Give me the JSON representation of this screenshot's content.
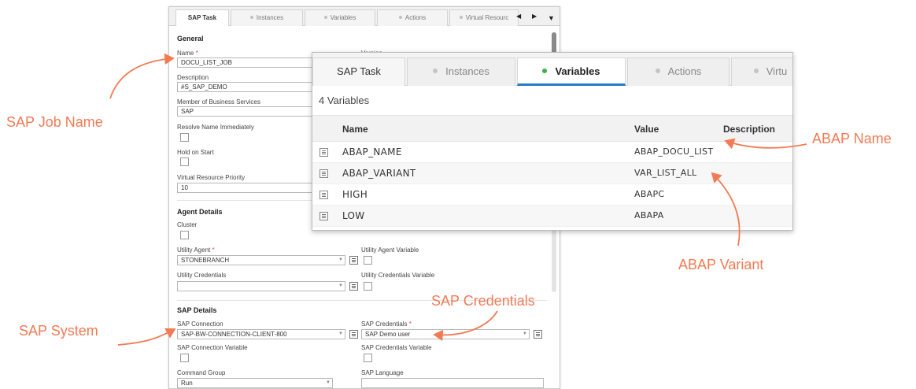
{
  "back_window": {
    "tabs": [
      {
        "label": "SAP Task",
        "active": true
      },
      {
        "label": "Instances"
      },
      {
        "label": "Variables"
      },
      {
        "label": "Actions"
      },
      {
        "label": "Virtual Resourc"
      }
    ],
    "general": {
      "section": "General",
      "name_label": "Name",
      "name_value": "DOCU_LIST_JOB",
      "version_label": "Version",
      "description_label": "Description",
      "description_value": "#S_SAP_DEMO",
      "business_services_label": "Member of Business Services",
      "business_services_value": "SAP",
      "resolve_name_label": "Resolve Name Immediately",
      "hold_on_start_label": "Hold on Start",
      "vr_priority_label": "Virtual Resource Priority",
      "vr_priority_value": "10"
    },
    "agent": {
      "section": "Agent Details",
      "cluster_label": "Cluster",
      "utility_agent_label": "Utility Agent",
      "utility_agent_value": "STONEBRANCH",
      "utility_agent_variable_label": "Utility Agent Variable",
      "utility_credentials_label": "Utility Credentials",
      "utility_credentials_variable_label": "Utility Credentials Variable"
    },
    "sap": {
      "section": "SAP Details",
      "connection_label": "SAP Connection",
      "connection_value": "SAP-BW-CONNECTION-CLIENT-800",
      "credentials_label": "SAP Credentials",
      "credentials_value": "SAP Demo user",
      "connection_variable_label": "SAP Connection Variable",
      "credentials_variable_label": "SAP Credentials Variable",
      "command_group_label": "Command Group",
      "command_group_value": "Run",
      "language_label": "SAP Language"
    }
  },
  "front_window": {
    "tabs": [
      {
        "label": "SAP Task"
      },
      {
        "label": "Instances"
      },
      {
        "label": "Variables",
        "active": true
      },
      {
        "label": "Actions"
      },
      {
        "label": "Virtu"
      }
    ],
    "count_text": "4 Variables",
    "columns": [
      "Name",
      "Value",
      "Description"
    ],
    "rows": [
      {
        "name": "ABAP_NAME",
        "value": "ABAP_DOCU_LIST"
      },
      {
        "name": "ABAP_VARIANT",
        "value": "VAR_LIST_ALL"
      },
      {
        "name": "HIGH",
        "value": "ABAPC"
      },
      {
        "name": "LOW",
        "value": "ABAPA"
      }
    ]
  },
  "callouts": {
    "job_name": "SAP Job Name",
    "system": "SAP System",
    "credentials": "SAP Credentials",
    "abap_name": "ABAP Name",
    "abap_variant": "ABAP Variant"
  },
  "colors": {
    "callout": "#f27a54",
    "active_tab_indicator": "#3bb04a",
    "active_tab_underline": "#2a79c9",
    "required_marker": "#e0463c"
  }
}
